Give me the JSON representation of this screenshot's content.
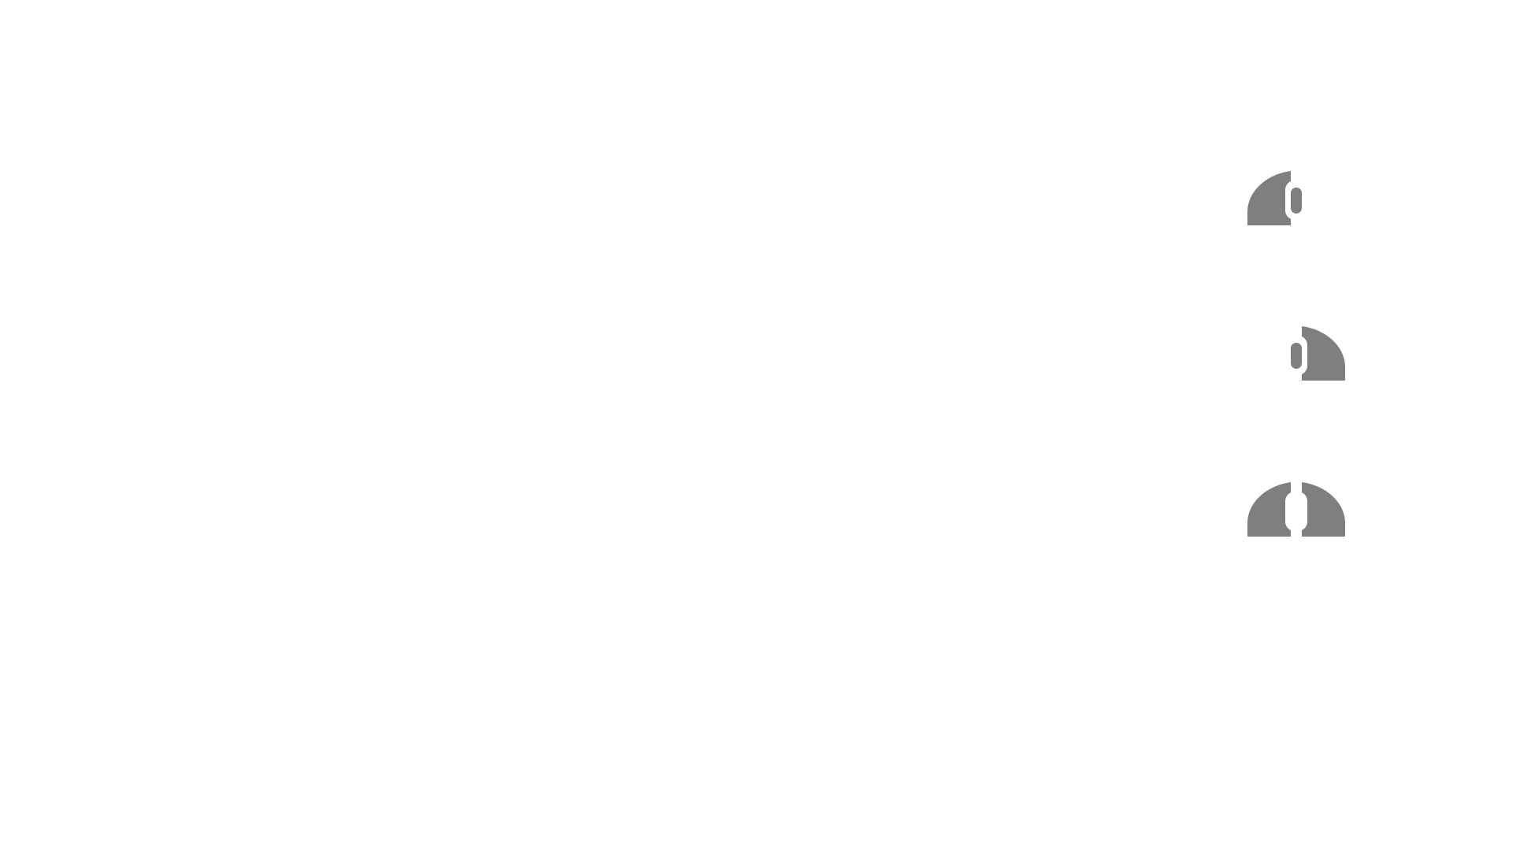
{
  "icon_color": "#7f7f7f",
  "icons": [
    {
      "name": "mouse-left-click-icon",
      "left": true,
      "right": false,
      "wheel": true
    },
    {
      "name": "mouse-right-click-icon",
      "left": false,
      "right": true,
      "wheel": true
    },
    {
      "name": "mouse-both-click-icon",
      "left": true,
      "right": true,
      "wheel": false
    }
  ]
}
